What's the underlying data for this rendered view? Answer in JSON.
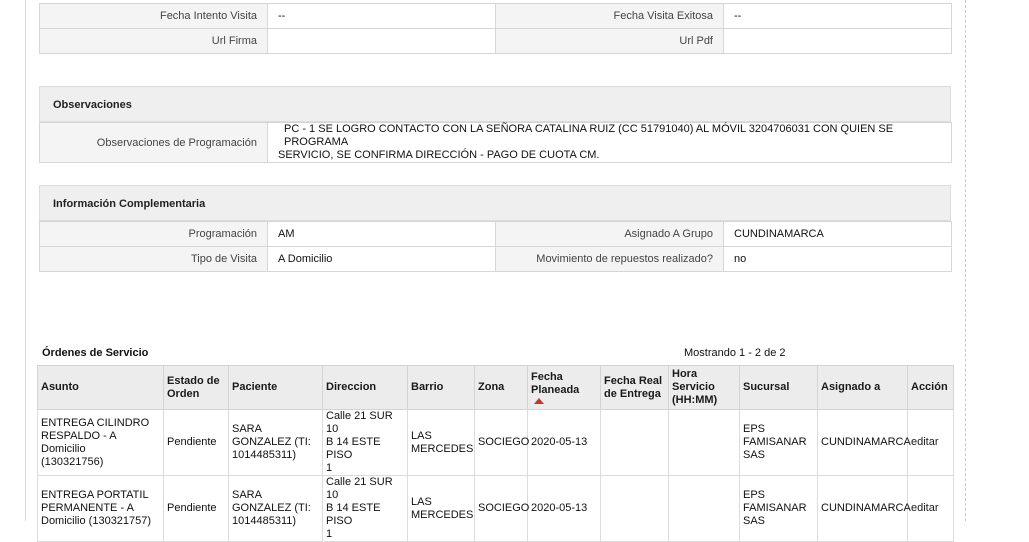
{
  "visit": {
    "fecha_intento_label": "Fecha Intento Visita",
    "fecha_intento_value": "--",
    "fecha_exitosa_label": "Fecha Visita Exitosa",
    "fecha_exitosa_value": "--",
    "url_firma_label": "Url Firma",
    "url_firma_value": "",
    "url_pdf_label": "Url Pdf",
    "url_pdf_value": ""
  },
  "observaciones": {
    "title": "Observaciones",
    "label": "Observaciones de Programación",
    "value_line1": "PC - 1 SE LOGRO CONTACTO CON LA SEÑORA CATALINA RUIZ (CC 51791040) AL MÓVIL 3204706031 CON QUIEN SE PROGRAMA",
    "value_line2": "SERVICIO, SE CONFIRMA DIRECCIÓN - PAGO DE CUOTA CM."
  },
  "complementaria": {
    "title": "Información Complementaria",
    "programacion_label": "Programación",
    "programacion_value": "AM",
    "grupo_label": "Asignado A Grupo",
    "grupo_value": "CUNDINAMARCA",
    "tipo_label": "Tipo de Visita",
    "tipo_value": "A Domicilio",
    "movimiento_label": "Movimiento de repuestos realizado?",
    "movimiento_value": "no"
  },
  "orders": {
    "title": "Órdenes de Servicio",
    "count": "Mostrando 1 - 2 de 2",
    "headers": {
      "asunto": "Asunto",
      "estado_1": "Estado de",
      "estado_2": "Orden",
      "paciente": "Paciente",
      "direccion": "Direccion",
      "barrio": "Barrio",
      "zona": "Zona",
      "fecha_planeada_1": "Fecha",
      "fecha_planeada_2": "Planeada",
      "fecha_real_1": "Fecha Real",
      "fecha_real_2": "de Entrega",
      "hora_1": "Hora",
      "hora_2": "Servicio",
      "hora_3": "(HH:MM)",
      "sucursal": "Sucursal",
      "asignado": "Asignado a",
      "accion": "Acción"
    },
    "rows": [
      {
        "asunto_1": "ENTREGA CILINDRO",
        "asunto_2": "RESPALDO - A Domicilio",
        "asunto_3": "(130321756)",
        "estado": "Pendiente",
        "paciente_1": "SARA",
        "paciente_2": "GONZALEZ (TI:",
        "paciente_3": "1014485311)",
        "direccion_1": "Calle 21 SUR 10",
        "direccion_2": "B 14 ESTE PISO",
        "direccion_3": "1",
        "barrio_1": "LAS",
        "barrio_2": "MERCEDES",
        "zona": "SOCIEGO",
        "fecha_planeada": "2020-05-13",
        "fecha_real": "",
        "hora": "",
        "sucursal_1": "EPS",
        "sucursal_2": "FAMISANAR",
        "sucursal_3": "SAS",
        "asignado": "CUNDINAMARCA",
        "accion": "editar"
      },
      {
        "asunto_1": "ENTREGA PORTATIL",
        "asunto_2": "PERMANENTE - A",
        "asunto_3": "Domicilio (130321757)",
        "estado": "Pendiente",
        "paciente_1": "SARA",
        "paciente_2": "GONZALEZ (TI:",
        "paciente_3": "1014485311)",
        "direccion_1": "Calle 21 SUR 10",
        "direccion_2": "B 14 ESTE PISO",
        "direccion_3": "1",
        "barrio_1": "LAS",
        "barrio_2": "MERCEDES",
        "zona": "SOCIEGO",
        "fecha_planeada": "2020-05-13",
        "fecha_real": "",
        "hora": "",
        "sucursal_1": "EPS",
        "sucursal_2": "FAMISANAR",
        "sucursal_3": "SAS",
        "asignado": "CUNDINAMARCA",
        "accion": "editar"
      }
    ]
  },
  "colors": {
    "sort_arrow": "#c0392b",
    "header_bg": "#ececec",
    "label_bg": "#f4f4f4"
  }
}
